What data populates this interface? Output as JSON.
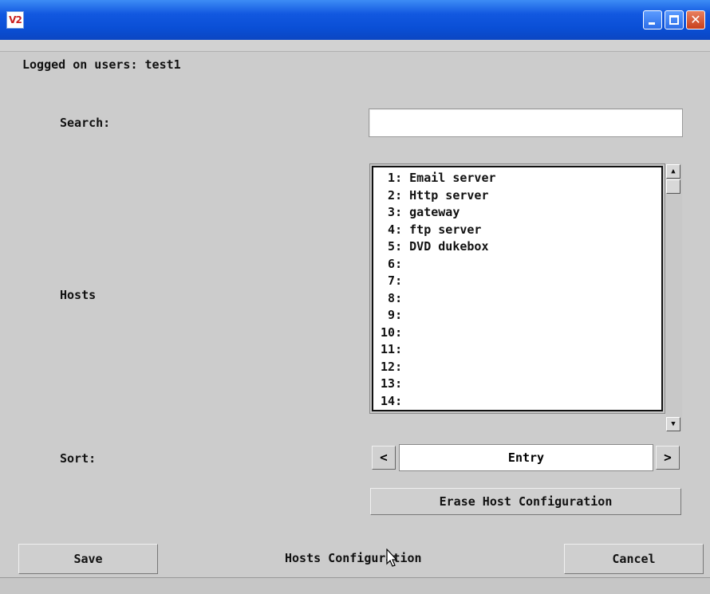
{
  "window": {
    "app_icon_text": "V2",
    "controls": {
      "minimize": "minimize-icon",
      "maximize": "maximize-icon",
      "close": "close-icon"
    },
    "titlebar_color": "#0a4fd6"
  },
  "logged_on": {
    "label": "Logged on users:",
    "users": "test1"
  },
  "search": {
    "label": "Search:",
    "value": ""
  },
  "hosts": {
    "label": "Hosts",
    "items": [
      "1: Email server",
      "2: Http server",
      "3: gateway",
      "4: ftp server",
      "5: DVD dukebox",
      "6:",
      "7:",
      "8:",
      "9:",
      "10:",
      "11:",
      "12:",
      "13:",
      "14:"
    ]
  },
  "sort": {
    "label": "Sort:",
    "value": "Entry",
    "prev": "<",
    "next": ">"
  },
  "erase_button": "Erase Host Configuration",
  "footer": {
    "save": "Save",
    "title": "Hosts Configuration",
    "cancel": "Cancel"
  }
}
